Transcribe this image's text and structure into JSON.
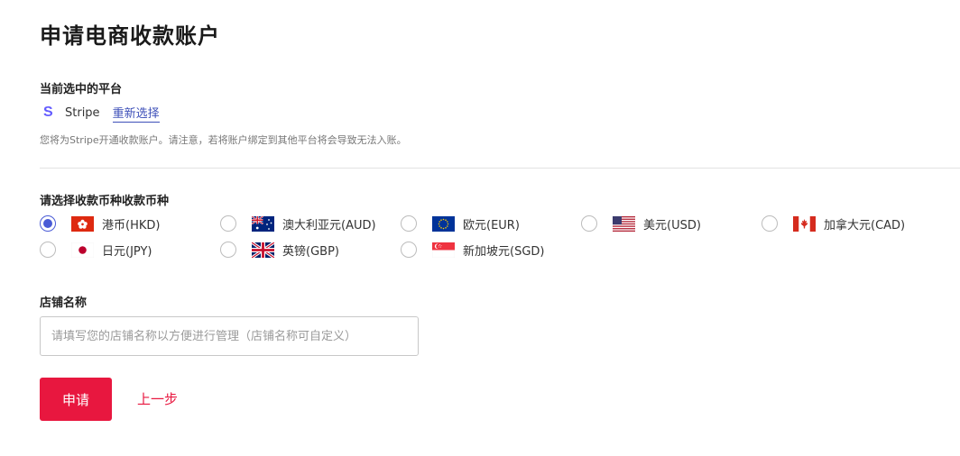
{
  "page": {
    "title": "申请电商收款账户"
  },
  "platform": {
    "section_label": "当前选中的平台",
    "icon": "stripe-s-icon",
    "name": "Stripe",
    "reselect_label": "重新选择",
    "hint": "您将为Stripe开通收款账户。请注意，若将账户绑定到其他平台将会导致无法入账。"
  },
  "currency": {
    "section_label": "请选择收款币种收款币种",
    "options": [
      {
        "label": "港币(HKD)",
        "flag": "hk-flag-icon",
        "selected": true
      },
      {
        "label": "澳大利亚元(AUD)",
        "flag": "au-flag-icon",
        "selected": false
      },
      {
        "label": "欧元(EUR)",
        "flag": "eu-flag-icon",
        "selected": false
      },
      {
        "label": "美元(USD)",
        "flag": "us-flag-icon",
        "selected": false
      },
      {
        "label": "加拿大元(CAD)",
        "flag": "ca-flag-icon",
        "selected": false
      },
      {
        "label": "日元(JPY)",
        "flag": "jp-flag-icon",
        "selected": false
      },
      {
        "label": "英镑(GBP)",
        "flag": "gb-flag-icon",
        "selected": false
      },
      {
        "label": "新加坡元(SGD)",
        "flag": "sg-flag-icon",
        "selected": false
      }
    ]
  },
  "store": {
    "section_label": "店铺名称",
    "value": "",
    "placeholder": "请填写您的店铺名称以方便进行管理（店铺名称可自定义）"
  },
  "actions": {
    "apply_label": "申请",
    "back_label": "上一步"
  },
  "colors": {
    "accent": "#e8173f",
    "link": "#3d4fb8",
    "radio_selected": "#4a5bd6",
    "stripe_brand": "#635bff"
  }
}
